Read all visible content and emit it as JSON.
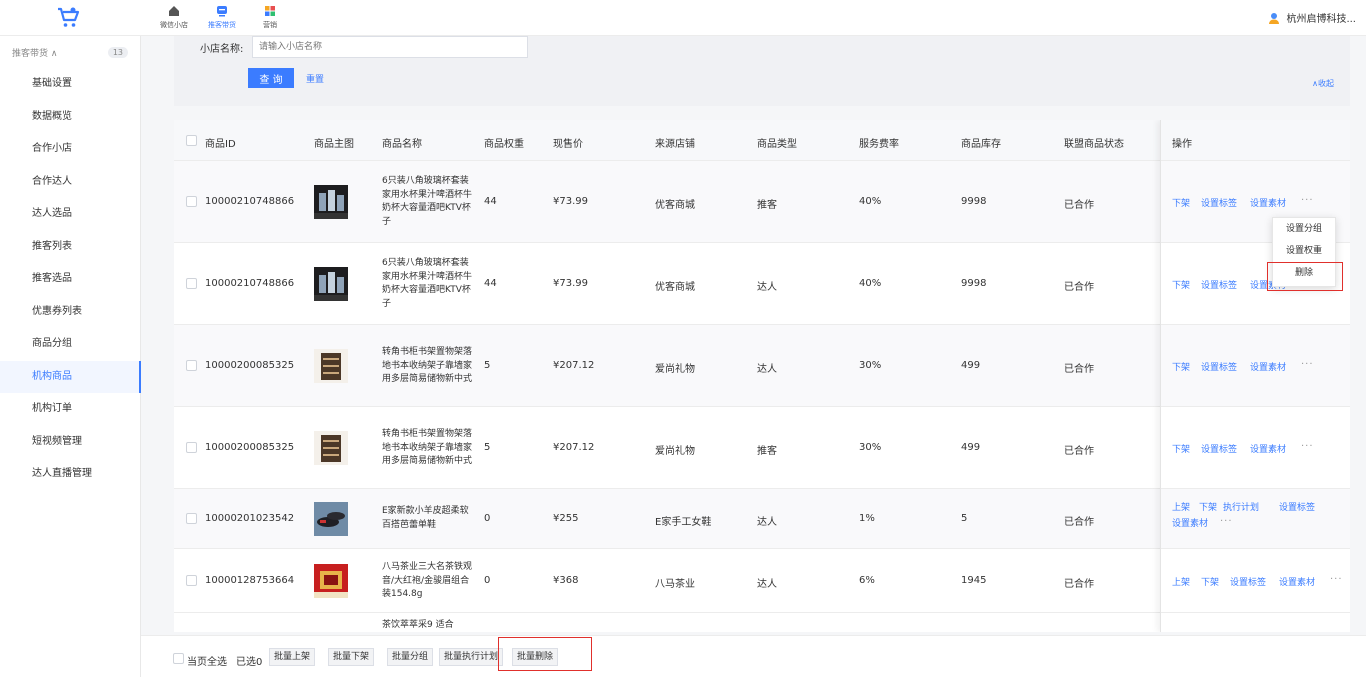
{
  "topnav": {
    "items": [
      {
        "label": "微信小店",
        "icon": "home-icon"
      },
      {
        "label": "推客带货",
        "icon": "chat-icon",
        "active": true
      },
      {
        "label": "营销",
        "icon": "grid-icon"
      }
    ]
  },
  "user": {
    "name": "杭州启博科技..."
  },
  "sidebar": {
    "group": {
      "label": "推客带货 ∧",
      "badge": "13"
    },
    "items": [
      "基础设置",
      "数据概览",
      "合作小店",
      "合作达人",
      "达人选品",
      "推客列表",
      "推客选品",
      "优惠券列表",
      "商品分组",
      "机构商品",
      "机构订单",
      "短视频管理",
      "达人直播管理"
    ],
    "active_index": 9
  },
  "filter": {
    "label": "小店名称:",
    "placeholder": "请输入小店名称",
    "query": "查 询",
    "reset": "重置",
    "collapse": "∧收起"
  },
  "table": {
    "headers": [
      "商品ID",
      "商品主图",
      "商品名称",
      "商品权重",
      "现售价",
      "来源店铺",
      "商品类型",
      "服务费率",
      "商品库存",
      "联盟商品状态",
      "操作"
    ],
    "rows": [
      {
        "id": "10000210748866",
        "name": "6只装八角玻璃杯套装家用水杯果汁啤酒杯牛奶杯大容量酒吧KTV杯子",
        "weight": "44",
        "price": "¥73.99",
        "shop": "优客商城",
        "type": "推客",
        "rate": "40%",
        "stock": "9998",
        "status": "已合作",
        "ops": [
          "下架",
          "设置标签",
          "设置素材"
        ],
        "more": "···",
        "thumb": "glasses"
      },
      {
        "id": "10000210748866",
        "name": "6只装八角玻璃杯套装家用水杯果汁啤酒杯牛奶杯大容量酒吧KTV杯子",
        "weight": "44",
        "price": "¥73.99",
        "shop": "优客商城",
        "type": "达人",
        "rate": "40%",
        "stock": "9998",
        "status": "已合作",
        "ops": [
          "下架",
          "设置标签",
          "设置素材"
        ],
        "more": "",
        "thumb": "glasses"
      },
      {
        "id": "10000200085325",
        "name": "转角书柜书架置物架落地书本收纳架子靠墙家用多层简易储物新中式",
        "weight": "5",
        "price": "¥207.12",
        "shop": "爱尚礼物",
        "type": "达人",
        "rate": "30%",
        "stock": "499",
        "status": "已合作",
        "ops": [
          "下架",
          "设置标签",
          "设置素材"
        ],
        "more": "···",
        "thumb": "shelf"
      },
      {
        "id": "10000200085325",
        "name": "转角书柜书架置物架落地书本收纳架子靠墙家用多层简易储物新中式",
        "weight": "5",
        "price": "¥207.12",
        "shop": "爱尚礼物",
        "type": "推客",
        "rate": "30%",
        "stock": "499",
        "status": "已合作",
        "ops": [
          "下架",
          "设置标签",
          "设置素材"
        ],
        "more": "···",
        "thumb": "shelf"
      },
      {
        "id": "10000201023542",
        "name": "E家新款小羊皮超柔软百搭芭蕾单鞋",
        "weight": "0",
        "price": "¥255",
        "shop": "E家手工女鞋",
        "type": "达人",
        "rate": "1%",
        "stock": "5",
        "status": "已合作",
        "ops": [
          "上架",
          "下架",
          "执行计划",
          "设置标签",
          "设置素材"
        ],
        "more": "···",
        "thumb": "shoes"
      },
      {
        "id": "10000128753664",
        "name": "八马茶业三大名茶铁观音/大红袍/金骏眉组合装154.8g",
        "weight": "0",
        "price": "¥368",
        "shop": "八马茶业",
        "type": "达人",
        "rate": "6%",
        "stock": "1945",
        "status": "已合作",
        "ops": [
          "上架",
          "下架",
          "设置标签",
          "设置素材"
        ],
        "more": "···",
        "thumb": "tea"
      }
    ],
    "partial_row_text": "茶饮萃萃采9 适合"
  },
  "dropdown": {
    "items": [
      "设置分组",
      "设置权重",
      "删除"
    ]
  },
  "footer": {
    "select_all": "当页全选",
    "selected": "已选0",
    "buttons": [
      "批量上架",
      "批量下架",
      "批量分组",
      "批量执行计划",
      "批量删除"
    ]
  },
  "colors": {
    "accent": "#3b7cff",
    "highlight": "#e0302c"
  }
}
